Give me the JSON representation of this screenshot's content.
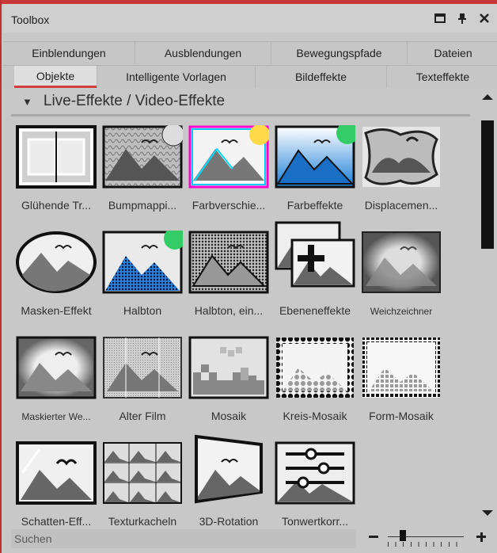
{
  "window": {
    "title": "Toolbox",
    "controls": [
      "maximize-icon",
      "pin-icon",
      "close-icon"
    ]
  },
  "tabs_row1": [
    {
      "label": "Einblendungen"
    },
    {
      "label": "Ausblendungen"
    },
    {
      "label": "Bewegungspfade"
    },
    {
      "label": "Dateien"
    }
  ],
  "tabs_row2": [
    {
      "label": "Objekte",
      "active": true
    },
    {
      "label": "Intelligente Vorlagen"
    },
    {
      "label": "Bildeffekte"
    },
    {
      "label": "Texteffekte"
    }
  ],
  "section": {
    "title": "Live-Effekte / Video-Effekte",
    "expanded": true
  },
  "effects": [
    {
      "label": "Glühende Tr...",
      "icon": "glow-transition-icon"
    },
    {
      "label": "Bumpmappi...",
      "icon": "bumpmapping-icon"
    },
    {
      "label": "Farbverschie...",
      "icon": "color-shift-icon"
    },
    {
      "label": "Farbeffekte",
      "icon": "color-effects-icon"
    },
    {
      "label": "Displacemen...",
      "icon": "displacement-icon"
    },
    {
      "label": "Masken-Effekt",
      "icon": "mask-effect-icon"
    },
    {
      "label": "Halbton",
      "icon": "halftone-icon"
    },
    {
      "label": "Halbton, ein...",
      "icon": "halftone-mono-icon"
    },
    {
      "label": "Ebeneneffekte",
      "icon": "layer-effects-icon"
    },
    {
      "label": "Weichzeichner",
      "icon": "blur-icon"
    },
    {
      "label": "Maskierter We...",
      "icon": "masked-blur-icon"
    },
    {
      "label": "Alter Film",
      "icon": "old-film-icon"
    },
    {
      "label": "Mosaik",
      "icon": "mosaic-icon"
    },
    {
      "label": "Kreis-Mosaik",
      "icon": "circle-mosaic-icon"
    },
    {
      "label": "Form-Mosaik",
      "icon": "shape-mosaic-icon"
    },
    {
      "label": "Schatten-Eff...",
      "icon": "shadow-effect-icon"
    },
    {
      "label": "Texturkacheln",
      "icon": "texture-tiles-icon"
    },
    {
      "label": "3D-Rotation",
      "icon": "3d-rotation-icon"
    },
    {
      "label": "Tonwertkorr...",
      "icon": "tone-correction-icon"
    }
  ],
  "search": {
    "placeholder": "Suchen"
  },
  "zoom": {
    "level": 0.2
  }
}
